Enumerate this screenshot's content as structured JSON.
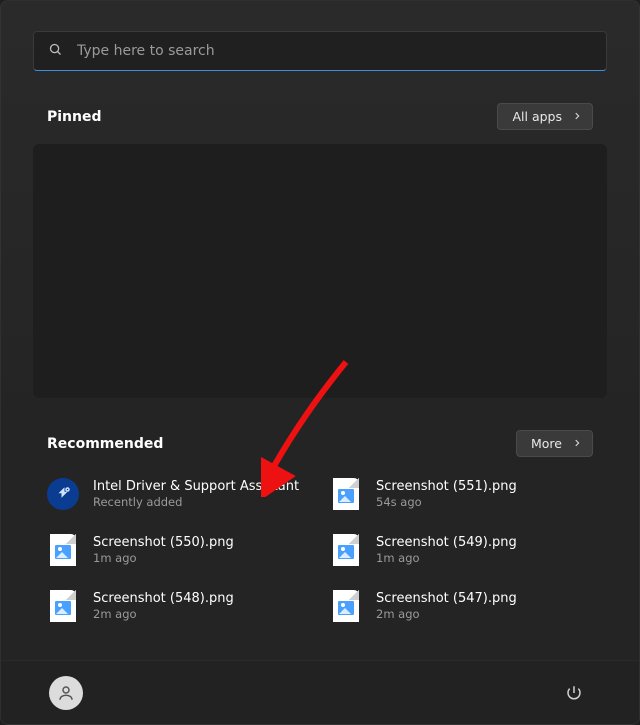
{
  "search": {
    "placeholder": "Type here to search"
  },
  "pinned": {
    "title": "Pinned",
    "all_apps_label": "All apps"
  },
  "recommended": {
    "title": "Recommended",
    "more_label": "More",
    "items": [
      {
        "title": "Intel Driver & Support Assistant",
        "subtitle": "Recently added",
        "icon": "intel"
      },
      {
        "title": "Screenshot (551).png",
        "subtitle": "54s ago",
        "icon": "image-file"
      },
      {
        "title": "Screenshot (550).png",
        "subtitle": "1m ago",
        "icon": "image-file"
      },
      {
        "title": "Screenshot (549).png",
        "subtitle": "1m ago",
        "icon": "image-file"
      },
      {
        "title": "Screenshot (548).png",
        "subtitle": "2m ago",
        "icon": "image-file"
      },
      {
        "title": "Screenshot (547).png",
        "subtitle": "2m ago",
        "icon": "image-file"
      }
    ]
  }
}
